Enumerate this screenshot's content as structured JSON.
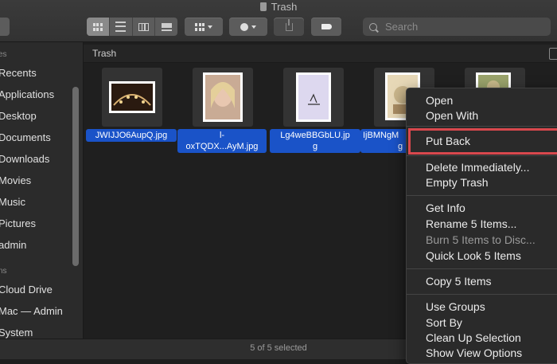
{
  "window": {
    "title": "Trash"
  },
  "toolbar": {
    "view_modes": [
      "icon-view",
      "list-view",
      "column-view",
      "gallery-view"
    ],
    "search_placeholder": "Search"
  },
  "sidebar": {
    "favorites_header": "es",
    "items": [
      "Recents",
      "Applications",
      "Desktop",
      "Documents",
      "Downloads",
      "Movies",
      "Music",
      "Pictures",
      "admin"
    ],
    "locations_header": "ns",
    "locations": [
      "Cloud Drive",
      "Mac — Admin",
      "System"
    ]
  },
  "pathbar": {
    "label": "Trash"
  },
  "files": [
    {
      "name_line1": "JWIJJO6AupQ.jpg",
      "name_line2": ""
    },
    {
      "name_line1": "l-",
      "name_line2": "oxTQDX...AyM.jpg"
    },
    {
      "name_line1": "Lg4weBBGbLU.jp",
      "name_line2": "g"
    },
    {
      "name_line1": "IjBMNgM",
      "name_line2": "g"
    }
  ],
  "status": {
    "text": "5 of 5 selected"
  },
  "context_menu": {
    "open": "Open",
    "open_with": "Open With",
    "put_back": "Put Back",
    "delete_immediately": "Delete Immediately...",
    "empty_trash": "Empty Trash",
    "get_info": "Get Info",
    "rename": "Rename 5 Items...",
    "burn": "Burn 5 Items to Disc...",
    "quick_look": "Quick Look 5 Items",
    "copy": "Copy 5 Items",
    "use_groups": "Use Groups",
    "sort_by": "Sort By",
    "clean_up": "Clean Up Selection",
    "show_view_options": "Show View Options"
  },
  "colors": {
    "selection": "#1a53c8",
    "highlight_box": "#d8484d"
  }
}
